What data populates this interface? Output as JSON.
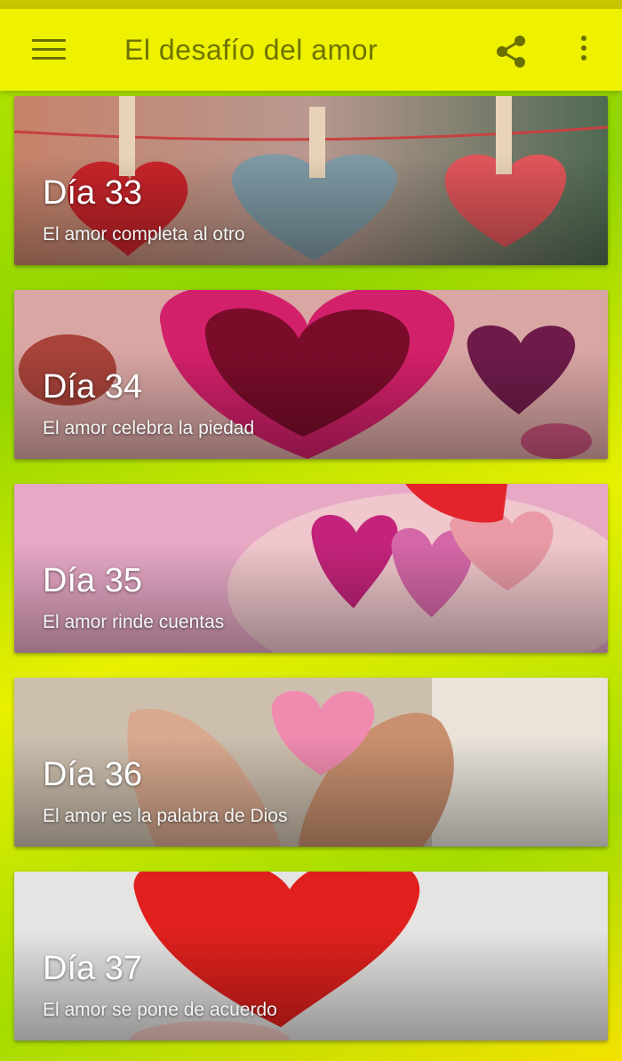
{
  "app": {
    "title": "El desafío del amor"
  },
  "toolbar": {
    "menu_icon": "hamburger-menu-icon",
    "share_icon": "share-icon",
    "more_icon": "more-vertical-icon"
  },
  "colors": {
    "appbar": "#eef200",
    "appbar_text": "#6f7300",
    "background": "#a4dc00"
  },
  "cards": [
    {
      "day": "Día 33",
      "subtitle": "El amor completa al otro",
      "image": "hearts-on-clothesline"
    },
    {
      "day": "Día 34",
      "subtitle": "El amor celebra la piedad",
      "image": "pink-paper-heart"
    },
    {
      "day": "Día 35",
      "subtitle": "El amor rinde cuentas",
      "image": "gloved-hands-holding-hearts"
    },
    {
      "day": "Día 36",
      "subtitle": "El amor es la palabra de Dios",
      "image": "hands-holding-pink-heart"
    },
    {
      "day": "Día 37",
      "subtitle": "El amor se pone de acuerdo",
      "image": "red-fluffy-heart"
    }
  ]
}
